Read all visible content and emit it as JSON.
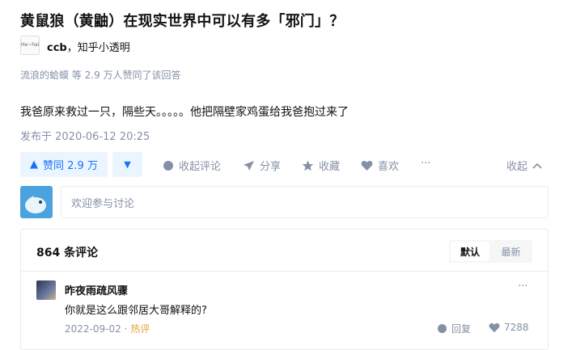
{
  "question": {
    "title": "黄鼠狼（黄鼬）在现实世界中可以有多「邪门」？"
  },
  "author": {
    "avatar_text": "He~hai",
    "name": "ccb",
    "separator": "，",
    "bio": "知乎小透明"
  },
  "upvoters_text": "流浪的蛤蟆 等 2.9 万人赞同了该回答",
  "answer": {
    "content": "我爸原来救过一只，隔些天。。。。。他把隔壁家鸡蛋给我爸抱过来了",
    "published": "发布于 2020-06-12 20:25"
  },
  "actions": {
    "upvote_label": "赞同 2.9 万",
    "comments_label": "收起评论",
    "share_label": "分享",
    "collect_label": "收藏",
    "like_label": "喜欢",
    "more": "···",
    "collapse_label": "收起"
  },
  "comment_box": {
    "placeholder": "欢迎参与讨论"
  },
  "comments": {
    "count_label": "864 条评论",
    "sort": {
      "default": "默认",
      "latest": "最新"
    },
    "items": [
      {
        "name": "昨夜雨疏风骤",
        "text": "你就是这么跟邻居大哥解释的?",
        "date": "2022-09-02",
        "dot": "·",
        "hot": "热评",
        "reply_label": "回复",
        "likes": "7288"
      }
    ]
  },
  "colors": {
    "accent": "#1772f6",
    "accent_bg": "#ebf5ff",
    "muted": "#8590a6",
    "hot": "#e6a23c"
  }
}
